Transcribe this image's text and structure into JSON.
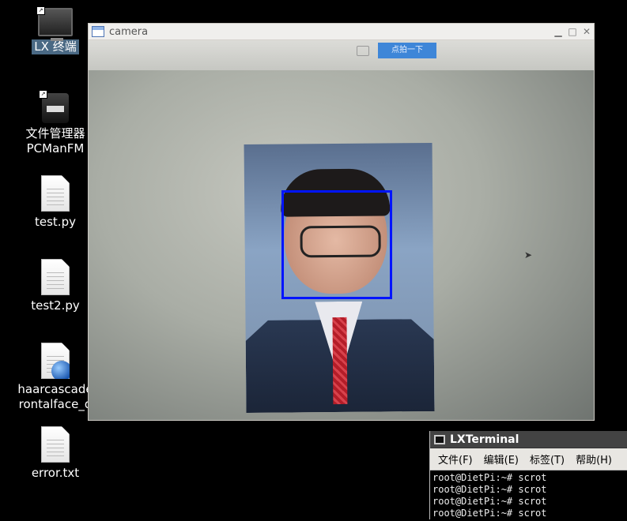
{
  "desktop": {
    "icons": [
      {
        "label": "LX 终端"
      },
      {
        "label": "文件管理器\nPCManFM"
      },
      {
        "label": "test.py"
      },
      {
        "label": "test2.py"
      },
      {
        "label": "haarcascade\nrontalface_d"
      },
      {
        "label": "error.txt"
      }
    ]
  },
  "camera_window": {
    "title": "camera",
    "min_glyph": "▁",
    "max_glyph": "□",
    "close_glyph": "✕",
    "screen_button": "点拍一下",
    "face_box_color": "#0014ff"
  },
  "terminal": {
    "title": "LXTerminal",
    "menu": [
      "文件(F)",
      "编辑(E)",
      "标签(T)",
      "帮助(H)"
    ],
    "lines": [
      "root@DietPi:~# scrot",
      "root@DietPi:~# scrot",
      "root@DietPi:~# scrot",
      "root@DietPi:~# scrot"
    ]
  }
}
